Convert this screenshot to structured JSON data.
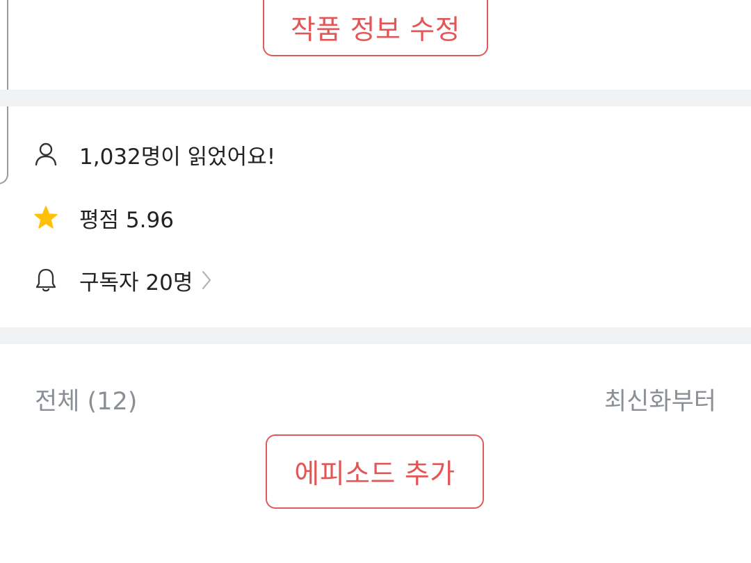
{
  "work": {
    "edit_button_label": "작품 정보 수정"
  },
  "stats": {
    "readers_text": "1,032명이 읽었어요!",
    "rating_text": "평점 5.96",
    "subscribers_text": "구독자 20명",
    "icons": {
      "readers": "person-icon",
      "rating": "star-icon",
      "subscribers": "bell-icon",
      "more": "chevron-right-icon"
    },
    "star_color": "#FFC107"
  },
  "episodes": {
    "header_label": "전체 (12)",
    "sort_label": "최신화부터",
    "add_button_label": "에피소드 추가"
  },
  "colors": {
    "accent": "#E05A5A",
    "muted_text": "#8A8F96",
    "divider": "#F1F2F4"
  }
}
